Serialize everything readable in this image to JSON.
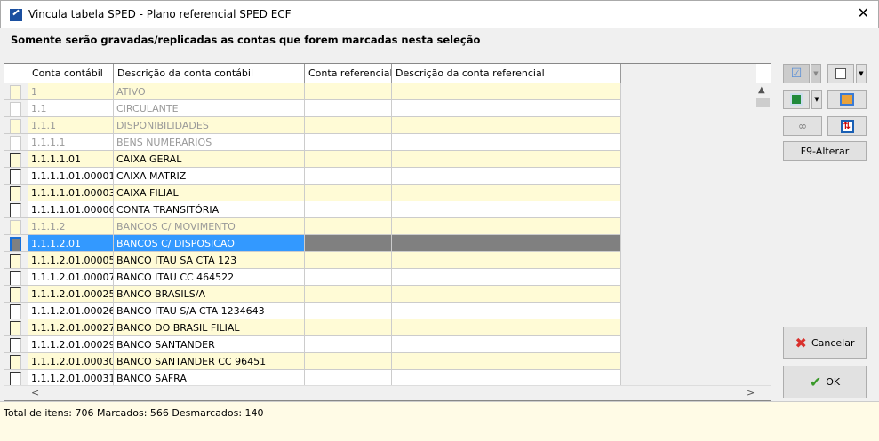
{
  "window": {
    "title": "Vincula tabela SPED - Plano referencial SPED ECF",
    "close": "✕"
  },
  "notice": "Somente serão gravadas/replicadas as contas que forem marcadas nesta seleção",
  "columns": [
    "",
    "Conta contábil",
    "Descrição da conta contábil",
    "Conta referencial",
    "Descrição da conta referencial"
  ],
  "rows": [
    {
      "conta": "1",
      "desc": "ATIVO",
      "ref": "",
      "descref": "",
      "style": "group"
    },
    {
      "conta": "1.1",
      "desc": "CIRCULANTE",
      "ref": "",
      "descref": "",
      "style": "group"
    },
    {
      "conta": "1.1.1",
      "desc": "DISPONIBILIDADES",
      "ref": "",
      "descref": "",
      "style": "group"
    },
    {
      "conta": "1.1.1.1",
      "desc": "BENS NUMERARIOS",
      "ref": "",
      "descref": "",
      "style": "group"
    },
    {
      "conta": "1.1.1.1.01",
      "desc": "CAIXA GERAL",
      "ref": "",
      "descref": "",
      "style": "normal"
    },
    {
      "conta": "1.1.1.1.01.00001",
      "desc": "CAIXA MATRIZ",
      "ref": "",
      "descref": "",
      "style": "normal"
    },
    {
      "conta": "1.1.1.1.01.00003",
      "desc": "CAIXA  FILIAL",
      "ref": "",
      "descref": "",
      "style": "normal"
    },
    {
      "conta": "1.1.1.1.01.00006",
      "desc": "CONTA TRANSITÓRIA",
      "ref": "",
      "descref": "",
      "style": "normal"
    },
    {
      "conta": "1.1.1.2",
      "desc": "BANCOS C/ MOVIMENTO",
      "ref": "",
      "descref": "",
      "style": "group"
    },
    {
      "conta": "1.1.1.2.01",
      "desc": "BANCOS C/ DISPOSICAO",
      "ref": "",
      "descref": "",
      "style": "selected"
    },
    {
      "conta": "1.1.1.2.01.00005",
      "desc": "BANCO ITAU SA CTA 123",
      "ref": "",
      "descref": "",
      "style": "normal"
    },
    {
      "conta": "1.1.1.2.01.00007",
      "desc": "BANCO ITAU CC 464522",
      "ref": "",
      "descref": "",
      "style": "normal"
    },
    {
      "conta": "1.1.1.2.01.00025",
      "desc": "BANCO BRASILS/A",
      "ref": "",
      "descref": "",
      "style": "normal"
    },
    {
      "conta": "1.1.1.2.01.00026",
      "desc": "BANCO ITAU S/A CTA 1234643",
      "ref": "",
      "descref": "",
      "style": "normal"
    },
    {
      "conta": "1.1.1.2.01.00027",
      "desc": "BANCO DO BRASIL FILIAL",
      "ref": "",
      "descref": "",
      "style": "normal"
    },
    {
      "conta": "1.1.1.2.01.00029",
      "desc": "BANCO SANTANDER",
      "ref": "",
      "descref": "",
      "style": "normal"
    },
    {
      "conta": "1.1.1.2.01.00030",
      "desc": "BANCO SANTANDER CC 96451",
      "ref": "",
      "descref": "",
      "style": "normal"
    },
    {
      "conta": "1.1.1.2.01.00031",
      "desc": "BANCO SAFRA",
      "ref": "",
      "descref": "",
      "style": "normal"
    }
  ],
  "side": {
    "f9": "F9-Alterar",
    "cancel": "Cancelar",
    "ok": "OK"
  },
  "status": "Total de itens: 706 Marcados: 566 Desmarcados: 140"
}
